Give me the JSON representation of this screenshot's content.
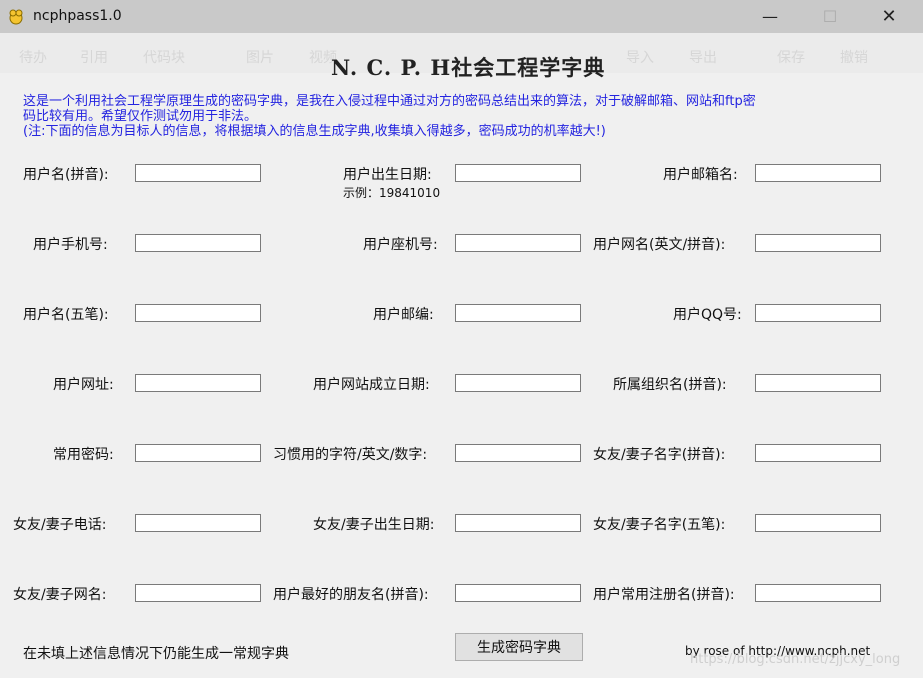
{
  "window": {
    "title": "ncphpass1.0",
    "min_glyph": "—",
    "max_glyph": "☐",
    "close_glyph": "✕"
  },
  "ghost_ribbon": {
    "items": [
      "待办",
      "引用",
      "代码块",
      "图片",
      "视频",
      "导入",
      "导出",
      "保存",
      "撤销"
    ]
  },
  "header": {
    "title": "N. C. P. H社会工程学字典",
    "description_line1": "这是一个利用社会工程学原理生成的密码字典，是我在入侵过程中通过对方的密码总结出来的算法，对于破解邮箱、网站和ftp密",
    "description_line2": "码比较有用。希望仅作测试勿用于非法。",
    "description_line3": "(注:下面的信息为目标人的信息，将根据填入的信息生成字典,收集填入得越多，密码成功的机率越大!)"
  },
  "fields": [
    {
      "label": "用户名(拼音):"
    },
    {
      "label": "用户出生日期:"
    },
    {
      "label": "用户邮箱名:"
    },
    {
      "label": "用户手机号:"
    },
    {
      "label": "用户座机号:"
    },
    {
      "label": "用户网名(英文/拼音):"
    },
    {
      "label": "用户名(五笔):"
    },
    {
      "label": "用户邮编:"
    },
    {
      "label": "用户QQ号:"
    },
    {
      "label": "用户网址:"
    },
    {
      "label": "用户网站成立日期:"
    },
    {
      "label": "所属组织名(拼音):"
    },
    {
      "label": "常用密码:"
    },
    {
      "label": "习惯用的字符/英文/数字:"
    },
    {
      "label": "女友/妻子名字(拼音):"
    },
    {
      "label": "女友/妻子电话:"
    },
    {
      "label": "女友/妻子出生日期:"
    },
    {
      "label": "女友/妻子名字(五笔):"
    },
    {
      "label": "女友/妻子网名:"
    },
    {
      "label": "用户最好的朋友名(拼音):"
    },
    {
      "label": "用户常用注册名(拼音):"
    }
  ],
  "birth_hint": "示例：19841010",
  "footer": {
    "note": "在未填上述信息情况下仍能生成一常规字典",
    "generate_button": "生成密码字典",
    "credit": "by rose of http://www.ncph.net",
    "watermark": "https://blog.csdn.net/zjjcxy_long"
  }
}
